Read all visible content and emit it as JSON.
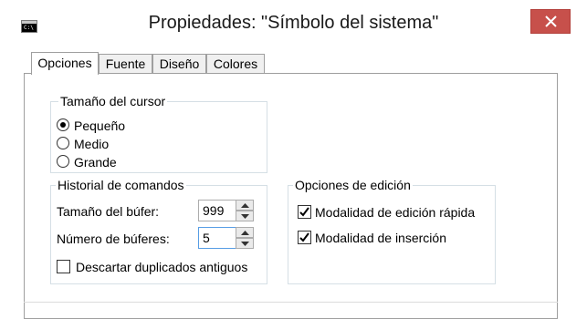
{
  "window": {
    "title": "Propiedades: \"Símbolo del sistema\"",
    "icon_name": "console-icon",
    "close_icon": "close-icon",
    "close_color": "#c7504b"
  },
  "tabs": [
    {
      "label": "Opciones",
      "active": true
    },
    {
      "label": "Fuente",
      "active": false
    },
    {
      "label": "Diseño",
      "active": false
    },
    {
      "label": "Colores",
      "active": false
    }
  ],
  "cursor_size": {
    "legend": "Tamaño del cursor",
    "options": [
      {
        "label": "Pequeño",
        "selected": true
      },
      {
        "label": "Medio",
        "selected": false
      },
      {
        "label": "Grande",
        "selected": false
      }
    ]
  },
  "command_history": {
    "legend": "Historial de comandos",
    "buffer_size_label": "Tamaño del búfer:",
    "buffer_size_value": "999",
    "buffer_count_label": "Número de búferes:",
    "buffer_count_value": "5",
    "discard_duplicates_label": "Descartar duplicados antiguos",
    "discard_duplicates_checked": false
  },
  "edit_options": {
    "legend": "Opciones de edición",
    "quick_edit_label": "Modalidad de edición rápida",
    "quick_edit_checked": true,
    "insert_mode_label": "Modalidad de inserción",
    "insert_mode_checked": true
  }
}
